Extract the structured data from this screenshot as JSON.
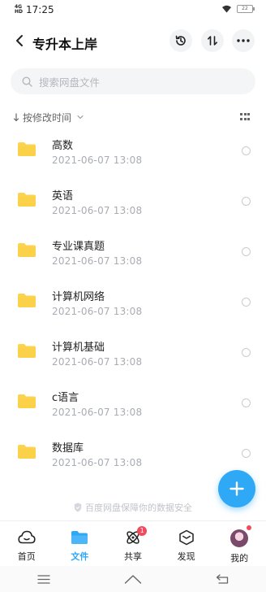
{
  "status_bar": {
    "network": "4G",
    "network_sub": "HD",
    "time": "17:25",
    "battery": "22"
  },
  "header": {
    "title": "专升本上岸",
    "icons": [
      "back-arrow-icon",
      "history-icon",
      "sort-icon",
      "more-icon"
    ]
  },
  "search": {
    "placeholder": "搜索网盘文件"
  },
  "sort": {
    "label": "按修改时间"
  },
  "files": [
    {
      "name": "高数",
      "date": "2021-06-07  13:08"
    },
    {
      "name": "英语",
      "date": "2021-06-07  13:08"
    },
    {
      "name": "专业课真题",
      "date": "2021-06-07  13:08"
    },
    {
      "name": "计算机网络",
      "date": "2021-06-07  13:08"
    },
    {
      "name": "计算机基础",
      "date": "2021-06-07  13:08"
    },
    {
      "name": "c语言",
      "date": "2021-06-07  13:08"
    },
    {
      "name": "数据库",
      "date": "2021-06-07  13:08"
    }
  ],
  "security_notice": "百度网盘保障你的数据安全",
  "tabs": [
    {
      "label": "首页"
    },
    {
      "label": "文件"
    },
    {
      "label": "共享",
      "badge": "1"
    },
    {
      "label": "发现"
    },
    {
      "label": "我的"
    }
  ],
  "colors": {
    "accent": "#2fa8f5",
    "folder": "#fcd34d",
    "badge": "#f24a5d"
  }
}
